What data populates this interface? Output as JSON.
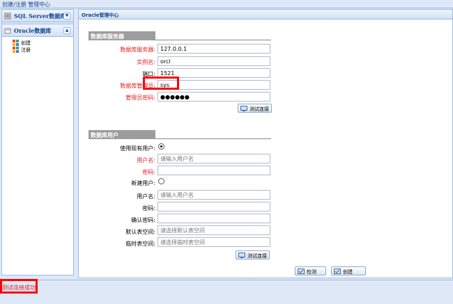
{
  "window": {
    "title": "创建/注册 管理中心"
  },
  "sidebar": {
    "sql_server_header": "SQL Server数据库",
    "oracle_header": "Oracle数据库",
    "items": [
      {
        "label": "创建",
        "icon": "create-icon"
      },
      {
        "label": "注册",
        "icon": "register-icon"
      }
    ]
  },
  "main": {
    "title": "Oracle管理中心",
    "server_section": {
      "title": "数据库服务器",
      "fields": {
        "server": {
          "label": "数据库服务器:",
          "value": "127.0.0.1"
        },
        "instance": {
          "label": "实例名:",
          "value": "orcl"
        },
        "port": {
          "label": "端口:",
          "value": "1521"
        },
        "admin": {
          "label": "数据库管理员:",
          "value": "sys"
        },
        "admin_password": {
          "label": "管理员密码:",
          "value": "●●●●●●"
        }
      },
      "test_button": "测试连接"
    },
    "user_section": {
      "title": "数据库用户",
      "use_existing_label": "使用现有用户:",
      "existing_username": {
        "label": "用户名:",
        "placeholder": "请输入用户名"
      },
      "existing_password": {
        "label": "密码:"
      },
      "new_user_label": "新建用户:",
      "new_username": {
        "label": "用户名:",
        "placeholder": "请输入用户名"
      },
      "new_password": {
        "label": "密码:"
      },
      "confirm_password": {
        "label": "确认密码:"
      },
      "default_tablespace": {
        "label": "默认表空间:",
        "placeholder": "请选择默认表空间"
      },
      "temp_tablespace": {
        "label": "临时表空间:",
        "placeholder": "请选择临时表空间"
      },
      "test_button": "测试连接"
    },
    "check_button": "检测",
    "create_button": "创建"
  },
  "status": {
    "message": "测试连接成功"
  },
  "colors": {
    "required_label": "#e02020",
    "highlight": "#ff0000",
    "header_text": "#15428b"
  }
}
